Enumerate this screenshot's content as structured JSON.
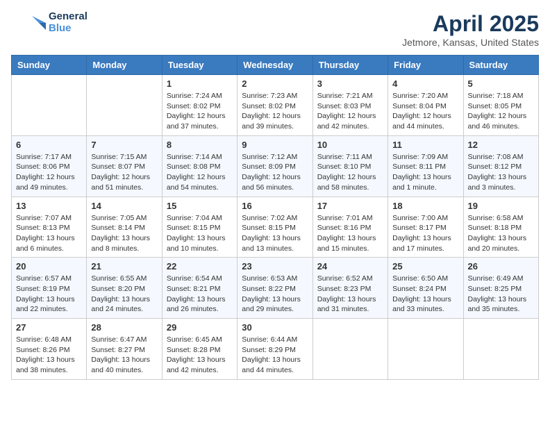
{
  "header": {
    "logo_line1": "General",
    "logo_line2": "Blue",
    "title": "April 2025",
    "subtitle": "Jetmore, Kansas, United States"
  },
  "calendar": {
    "days_of_week": [
      "Sunday",
      "Monday",
      "Tuesday",
      "Wednesday",
      "Thursday",
      "Friday",
      "Saturday"
    ],
    "weeks": [
      [
        {
          "day": "",
          "info": ""
        },
        {
          "day": "",
          "info": ""
        },
        {
          "day": "1",
          "info": "Sunrise: 7:24 AM\nSunset: 8:02 PM\nDaylight: 12 hours and 37 minutes."
        },
        {
          "day": "2",
          "info": "Sunrise: 7:23 AM\nSunset: 8:02 PM\nDaylight: 12 hours and 39 minutes."
        },
        {
          "day": "3",
          "info": "Sunrise: 7:21 AM\nSunset: 8:03 PM\nDaylight: 12 hours and 42 minutes."
        },
        {
          "day": "4",
          "info": "Sunrise: 7:20 AM\nSunset: 8:04 PM\nDaylight: 12 hours and 44 minutes."
        },
        {
          "day": "5",
          "info": "Sunrise: 7:18 AM\nSunset: 8:05 PM\nDaylight: 12 hours and 46 minutes."
        }
      ],
      [
        {
          "day": "6",
          "info": "Sunrise: 7:17 AM\nSunset: 8:06 PM\nDaylight: 12 hours and 49 minutes."
        },
        {
          "day": "7",
          "info": "Sunrise: 7:15 AM\nSunset: 8:07 PM\nDaylight: 12 hours and 51 minutes."
        },
        {
          "day": "8",
          "info": "Sunrise: 7:14 AM\nSunset: 8:08 PM\nDaylight: 12 hours and 54 minutes."
        },
        {
          "day": "9",
          "info": "Sunrise: 7:12 AM\nSunset: 8:09 PM\nDaylight: 12 hours and 56 minutes."
        },
        {
          "day": "10",
          "info": "Sunrise: 7:11 AM\nSunset: 8:10 PM\nDaylight: 12 hours and 58 minutes."
        },
        {
          "day": "11",
          "info": "Sunrise: 7:09 AM\nSunset: 8:11 PM\nDaylight: 13 hours and 1 minute."
        },
        {
          "day": "12",
          "info": "Sunrise: 7:08 AM\nSunset: 8:12 PM\nDaylight: 13 hours and 3 minutes."
        }
      ],
      [
        {
          "day": "13",
          "info": "Sunrise: 7:07 AM\nSunset: 8:13 PM\nDaylight: 13 hours and 6 minutes."
        },
        {
          "day": "14",
          "info": "Sunrise: 7:05 AM\nSunset: 8:14 PM\nDaylight: 13 hours and 8 minutes."
        },
        {
          "day": "15",
          "info": "Sunrise: 7:04 AM\nSunset: 8:15 PM\nDaylight: 13 hours and 10 minutes."
        },
        {
          "day": "16",
          "info": "Sunrise: 7:02 AM\nSunset: 8:15 PM\nDaylight: 13 hours and 13 minutes."
        },
        {
          "day": "17",
          "info": "Sunrise: 7:01 AM\nSunset: 8:16 PM\nDaylight: 13 hours and 15 minutes."
        },
        {
          "day": "18",
          "info": "Sunrise: 7:00 AM\nSunset: 8:17 PM\nDaylight: 13 hours and 17 minutes."
        },
        {
          "day": "19",
          "info": "Sunrise: 6:58 AM\nSunset: 8:18 PM\nDaylight: 13 hours and 20 minutes."
        }
      ],
      [
        {
          "day": "20",
          "info": "Sunrise: 6:57 AM\nSunset: 8:19 PM\nDaylight: 13 hours and 22 minutes."
        },
        {
          "day": "21",
          "info": "Sunrise: 6:55 AM\nSunset: 8:20 PM\nDaylight: 13 hours and 24 minutes."
        },
        {
          "day": "22",
          "info": "Sunrise: 6:54 AM\nSunset: 8:21 PM\nDaylight: 13 hours and 26 minutes."
        },
        {
          "day": "23",
          "info": "Sunrise: 6:53 AM\nSunset: 8:22 PM\nDaylight: 13 hours and 29 minutes."
        },
        {
          "day": "24",
          "info": "Sunrise: 6:52 AM\nSunset: 8:23 PM\nDaylight: 13 hours and 31 minutes."
        },
        {
          "day": "25",
          "info": "Sunrise: 6:50 AM\nSunset: 8:24 PM\nDaylight: 13 hours and 33 minutes."
        },
        {
          "day": "26",
          "info": "Sunrise: 6:49 AM\nSunset: 8:25 PM\nDaylight: 13 hours and 35 minutes."
        }
      ],
      [
        {
          "day": "27",
          "info": "Sunrise: 6:48 AM\nSunset: 8:26 PM\nDaylight: 13 hours and 38 minutes."
        },
        {
          "day": "28",
          "info": "Sunrise: 6:47 AM\nSunset: 8:27 PM\nDaylight: 13 hours and 40 minutes."
        },
        {
          "day": "29",
          "info": "Sunrise: 6:45 AM\nSunset: 8:28 PM\nDaylight: 13 hours and 42 minutes."
        },
        {
          "day": "30",
          "info": "Sunrise: 6:44 AM\nSunset: 8:29 PM\nDaylight: 13 hours and 44 minutes."
        },
        {
          "day": "",
          "info": ""
        },
        {
          "day": "",
          "info": ""
        },
        {
          "day": "",
          "info": ""
        }
      ]
    ]
  }
}
